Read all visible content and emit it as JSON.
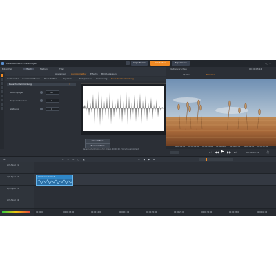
{
  "menu": [
    "Datei",
    "Bearbeiten",
    "Einstellungen"
  ],
  "top_buttons": [
    {
      "label": "Importieren",
      "active": false
    },
    {
      "label": "Bearbeiten",
      "active": true
    },
    {
      "label": "Exportieren",
      "active": false
    }
  ],
  "toolbar": [
    "Bibliothek",
    "Effekt",
    "Medien",
    "Titel"
  ],
  "effect_tabs": [
    "Anwenden",
    "Audiokorrektur",
    "Effekte",
    "Bild-Anpassung"
  ],
  "effect_panel": {
    "icon_items": [
      "Ausblenden",
      "Audiokorrekturen",
      "Rauschfilter",
      "Equalizer",
      "Kompressor",
      "Verzerrung",
      "Rauschunterdrückung"
    ],
    "section_title": "Rauschunterdrückung",
    "params": [
      {
        "label": "Rauschpegel",
        "value": "40"
      },
      {
        "label": "Frequenzbereich",
        "value": "0"
      },
      {
        "label": "Glättung",
        "value": "0"
      }
    ],
    "buttons": [
      "Rauschfilter",
      "Zurücksetzen"
    ],
    "status": "Rauschunterdrückung für 20 Sek. 00:00:00 - Vorschau erfolgreich"
  },
  "preview": {
    "title": "Medienvorschau",
    "tabs": [
      "Quelle",
      "Timeline"
    ],
    "timecode": "00:00:03:12",
    "ticks": [
      "00:00:01:00",
      "00:00:02:00",
      "00:00:03:00",
      "00:00:04:00",
      "00:00:05:00",
      "00:00:06:00",
      "00:00:07:00"
    ]
  },
  "tracks": [
    {
      "name": "A/V-Spur (1)"
    },
    {
      "name": "A/V-Spur (2)",
      "clip": "Weizenfeld.mp4"
    },
    {
      "name": "A/V-Spur (3)"
    },
    {
      "name": "A/V-Spur (4)"
    }
  ],
  "ruler": [
    "00:00:00",
    "00:00:05:00",
    "00:00:10:00",
    "00:00:15:00",
    "00:00:20:00",
    "00:00:25:00",
    "00:00:30:00",
    "00:00:35:00",
    "00:00:40:00"
  ],
  "colors": {
    "accent": "#f08a24",
    "selected_tab": "#4a7fb8",
    "clip": "#2f86c7"
  }
}
